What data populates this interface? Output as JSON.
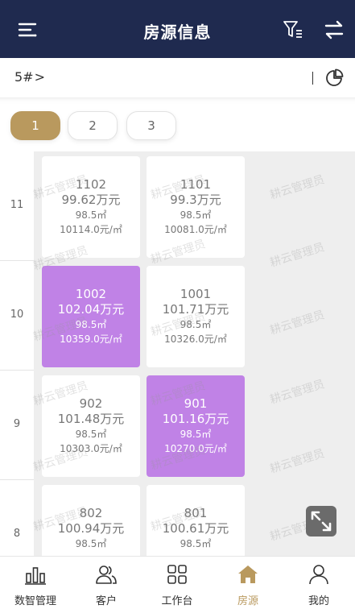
{
  "header": {
    "title": "房源信息",
    "menu_icon": "menu-icon",
    "filter_icon": "filter-icon",
    "switch_icon": "swap-icon",
    "bg_color": "#1f2a4f"
  },
  "subbar": {
    "building": "5#",
    "chevron": ">",
    "separator": "|",
    "stats_icon": "pie-chart-icon"
  },
  "unit_tabs": [
    "1",
    "2",
    "3"
  ],
  "active_unit": "1",
  "accent_color": "#b9995e",
  "sold_color": "#c082e6",
  "watermark": "耕云管理员",
  "floors": [
    {
      "label": "11",
      "rooms": [
        {
          "num": "1102",
          "price": "99.62万元",
          "area": "98.5㎡",
          "unit_price": "10114.0元/㎡",
          "status": "available"
        },
        {
          "num": "1101",
          "price": "99.3万元",
          "area": "98.5㎡",
          "unit_price": "10081.0元/㎡",
          "status": "available"
        }
      ]
    },
    {
      "label": "10",
      "rooms": [
        {
          "num": "1002",
          "price": "102.04万元",
          "area": "98.5㎡",
          "unit_price": "10359.0元/㎡",
          "status": "sold"
        },
        {
          "num": "1001",
          "price": "101.71万元",
          "area": "98.5㎡",
          "unit_price": "10326.0元/㎡",
          "status": "available"
        }
      ]
    },
    {
      "label": "9",
      "rooms": [
        {
          "num": "902",
          "price": "101.48万元",
          "area": "98.5㎡",
          "unit_price": "10303.0元/㎡",
          "status": "available"
        },
        {
          "num": "901",
          "price": "101.16万元",
          "area": "98.5㎡",
          "unit_price": "10270.0元/㎡",
          "status": "sold"
        }
      ]
    },
    {
      "label": "8",
      "rooms": [
        {
          "num": "802",
          "price": "100.94万元",
          "area": "98.5㎡",
          "unit_price": "",
          "status": "available"
        },
        {
          "num": "801",
          "price": "100.61万元",
          "area": "98.5㎡",
          "unit_price": "",
          "status": "available"
        }
      ]
    }
  ],
  "expand_icon": "expand-icon",
  "tabbar": [
    {
      "label": "数智管理",
      "icon": "bar-chart-icon",
      "active": false
    },
    {
      "label": "客户",
      "icon": "users-icon",
      "active": false
    },
    {
      "label": "工作台",
      "icon": "grid-icon",
      "active": false
    },
    {
      "label": "房源",
      "icon": "home-icon",
      "active": true
    },
    {
      "label": "我的",
      "icon": "user-icon",
      "active": false
    }
  ]
}
